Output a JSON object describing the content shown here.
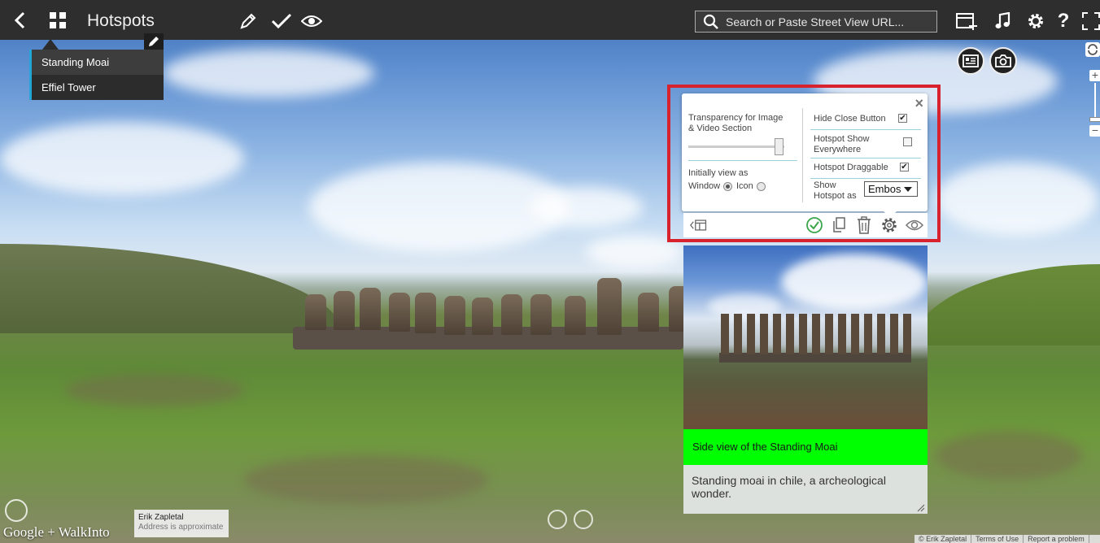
{
  "topbar": {
    "title": "Hotspots",
    "search_placeholder": "Search or Paste Street View URL...",
    "icons": [
      "back-arrow-icon",
      "grid-icon",
      "pencil-icon",
      "checkmark-icon",
      "eye-icon",
      "search-icon",
      "add-panel-icon",
      "music-icon",
      "gear-icon",
      "help-icon",
      "fullscreen-icon"
    ]
  },
  "dropdown": {
    "items": [
      "Standing Moai",
      "Effiel Tower"
    ]
  },
  "settings": {
    "transparency_label": "Transparency for Image & Video Section",
    "transparency_value": 1.0,
    "initial_view_label": "Initially view as",
    "window_label": "Window",
    "icon_label": "Icon",
    "initial_view_selected": "Window",
    "hide_close_label": "Hide Close Button",
    "hide_close_checked": true,
    "show_everywhere_label": "Hotspot Show Everywhere",
    "show_everywhere_checked": false,
    "draggable_label": "Hotspot Draggable",
    "draggable_checked": true,
    "show_as_label": "Show Hotspot as",
    "show_as_value": "Embos",
    "close_glyph": "×"
  },
  "hotspot": {
    "caption": "Side view of the Standing Moai",
    "description": "Standing moai in chile, a archeological wonder.",
    "caption_color": "#00ff00"
  },
  "author": {
    "name": "Erik Zapletal",
    "note": "Address is approximate"
  },
  "branding": {
    "logo_text": "Google + WalkInto"
  },
  "footer": {
    "copyright": "© Erik Zapletal",
    "terms": "Terms of Use",
    "report": "Report a problem"
  },
  "colors": {
    "topbar": "#2e2e2e",
    "highlight": "#d8232f",
    "accent": "#22a6d8",
    "check_green": "#3aa64a"
  }
}
